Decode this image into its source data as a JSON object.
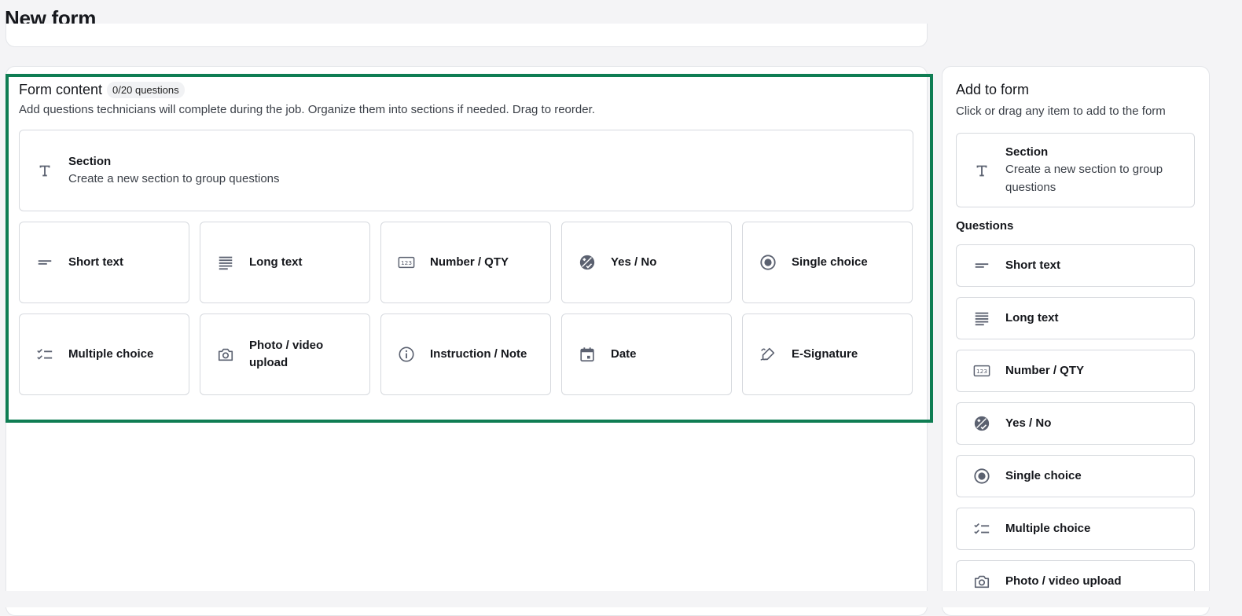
{
  "page": {
    "title": "New form"
  },
  "form_content": {
    "title": "Form content",
    "badge": "0/20 questions",
    "description": "Add questions technicians will complete during the job. Organize them into sections if needed. Drag to reorder.",
    "section": {
      "title": "Section",
      "subtitle": "Create a new section to group questions",
      "icon": "section-t-icon"
    },
    "items": [
      {
        "label": "Short text",
        "icon": "short-text-icon"
      },
      {
        "label": "Long text",
        "icon": "long-text-icon"
      },
      {
        "label": "Number / QTY",
        "icon": "number-icon"
      },
      {
        "label": "Yes / No",
        "icon": "yes-no-icon"
      },
      {
        "label": "Single choice",
        "icon": "single-choice-icon"
      },
      {
        "label": "Multiple choice",
        "icon": "multiple-choice-icon"
      },
      {
        "label": "Photo / video upload",
        "icon": "camera-icon"
      },
      {
        "label": "Instruction / Note",
        "icon": "info-icon"
      },
      {
        "label": "Date",
        "icon": "calendar-icon"
      },
      {
        "label": "E-Signature",
        "icon": "signature-icon"
      }
    ]
  },
  "sidebar": {
    "title": "Add to form",
    "description": "Click or drag any item to add to the form",
    "section": {
      "title": "Section",
      "subtitle": "Create a new section to group questions"
    },
    "questions_label": "Questions",
    "items": [
      {
        "label": "Short text"
      },
      {
        "label": "Long text"
      },
      {
        "label": "Number / QTY"
      },
      {
        "label": "Yes / No"
      },
      {
        "label": "Single choice"
      },
      {
        "label": "Multiple choice"
      },
      {
        "label": "Photo / video upload"
      }
    ]
  },
  "colors": {
    "highlight": "#0f7d53",
    "icon": "#5b6170"
  }
}
